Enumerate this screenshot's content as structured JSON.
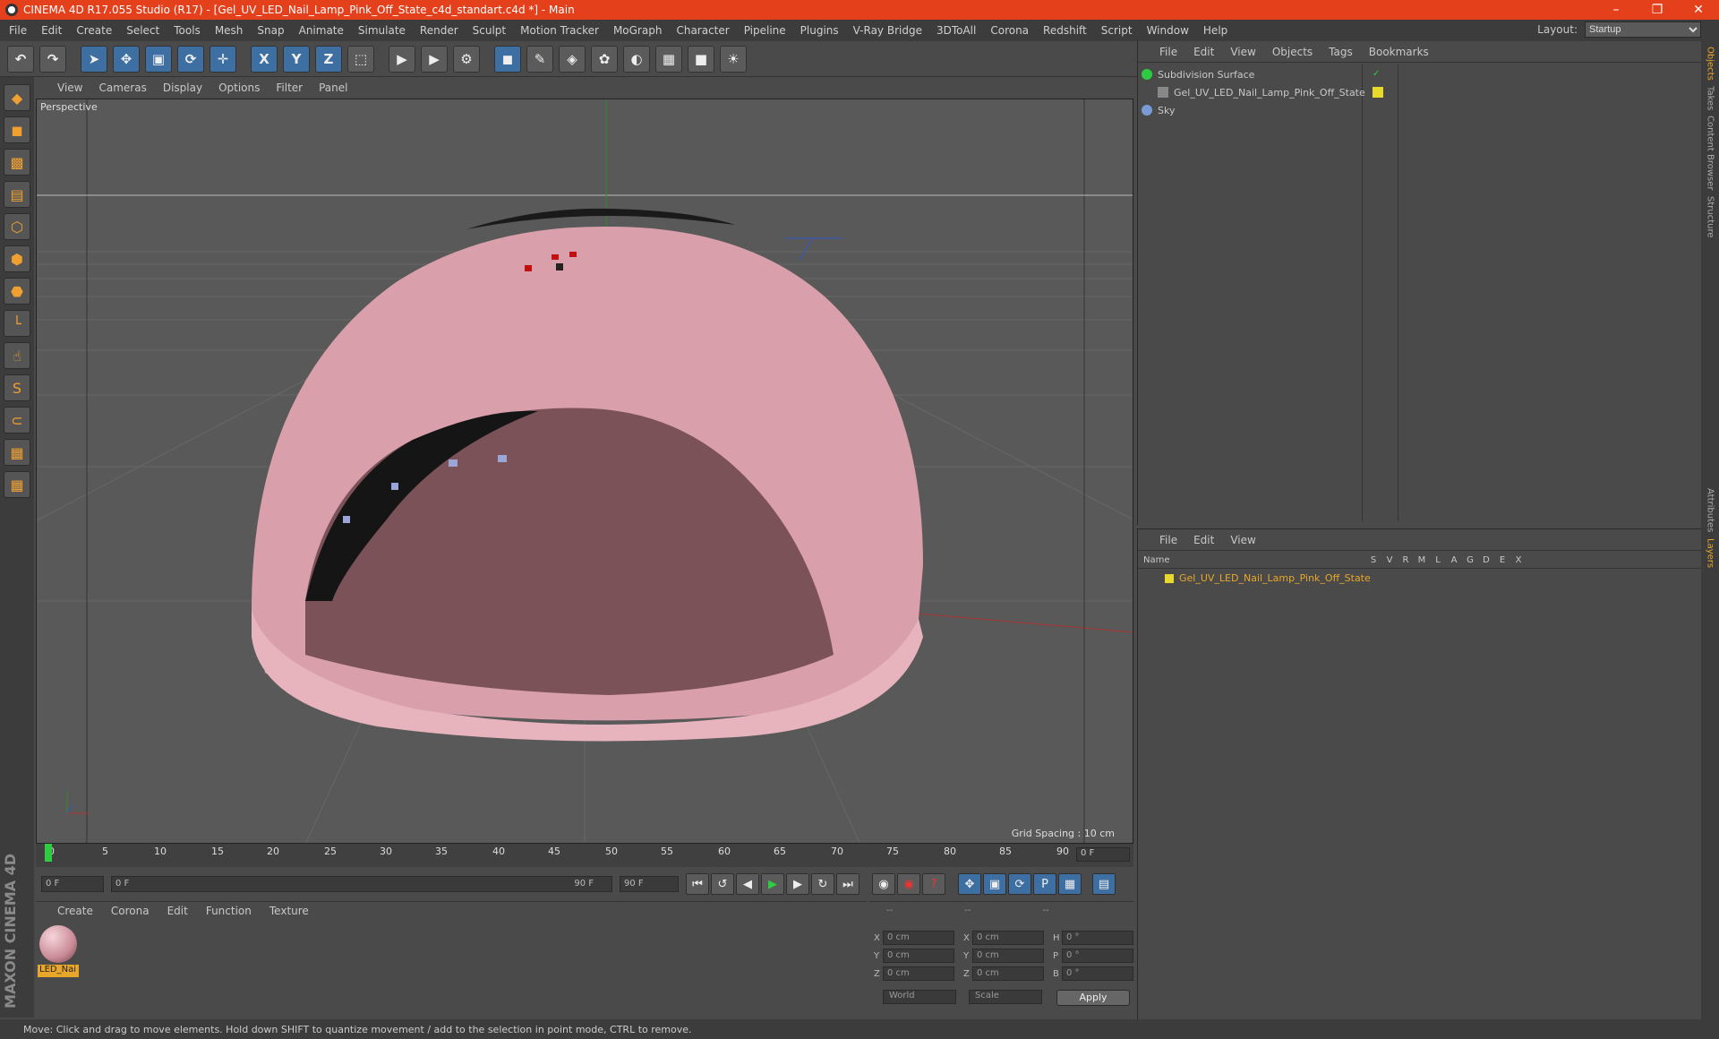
{
  "window": {
    "title": "CINEMA 4D R17.055 Studio (R17) - [Gel_UV_LED_Nail_Lamp_Pink_Off_State_c4d_standart.c4d *] - Main"
  },
  "menubar": {
    "items": [
      "File",
      "Edit",
      "Create",
      "Select",
      "Tools",
      "Mesh",
      "Snap",
      "Animate",
      "Simulate",
      "Render",
      "Sculpt",
      "Motion Tracker",
      "MoGraph",
      "Character",
      "Pipeline",
      "Plugins",
      "V-Ray Bridge",
      "3DToAll",
      "Corona",
      "Redshift",
      "Script",
      "Window",
      "Help"
    ],
    "layout_label": "Layout:",
    "layout_value": "Startup"
  },
  "viewport": {
    "menu": [
      "View",
      "Cameras",
      "Display",
      "Options",
      "Filter",
      "Panel"
    ],
    "label": "Perspective",
    "grid_spacing": "Grid Spacing : 10 cm"
  },
  "timeline": {
    "ticks": [
      "0",
      "5",
      "10",
      "15",
      "20",
      "25",
      "30",
      "35",
      "40",
      "45",
      "50",
      "55",
      "60",
      "65",
      "70",
      "75",
      "80",
      "85",
      "90"
    ],
    "current_frame": "0 F",
    "start": "0 F",
    "slider_start": "0 F",
    "slider_end": "90 F",
    "end": "90 F"
  },
  "materials": {
    "menu": [
      "Create",
      "Corona",
      "Edit",
      "Function",
      "Texture"
    ],
    "items": [
      {
        "name": "LED_Nai"
      }
    ]
  },
  "coords": {
    "headers": [
      "--",
      "--",
      "--"
    ],
    "rows": [
      {
        "a1": "X",
        "v1": "0 cm",
        "a2": "X",
        "v2": "0 cm",
        "a3": "H",
        "v3": "0 °"
      },
      {
        "a1": "Y",
        "v1": "0 cm",
        "a2": "Y",
        "v2": "0 cm",
        "a3": "P",
        "v3": "0 °"
      },
      {
        "a1": "Z",
        "v1": "0 cm",
        "a2": "Z",
        "v2": "0 cm",
        "a3": "B",
        "v3": "0 °"
      }
    ],
    "space": "World",
    "mode": "Scale",
    "apply": "Apply"
  },
  "object_manager": {
    "menu": [
      "File",
      "Edit",
      "View",
      "Objects",
      "Tags",
      "Bookmarks"
    ],
    "objects": [
      {
        "name": "Subdivision Surface"
      },
      {
        "name": "Gel_UV_LED_Nail_Lamp_Pink_Off_State"
      },
      {
        "name": "Sky"
      }
    ]
  },
  "layer_manager": {
    "menu": [
      "File",
      "Edit",
      "View"
    ],
    "name_header": "Name",
    "columns": [
      "S",
      "V",
      "R",
      "M",
      "L",
      "A",
      "G",
      "D",
      "E",
      "X"
    ],
    "layers": [
      {
        "name": "Gel_UV_LED_Nail_Lamp_Pink_Off_State"
      }
    ]
  },
  "side_tabs": [
    "Objects",
    "Takes",
    "Content Browser",
    "Structure",
    "Attributes",
    "Layers"
  ],
  "status": "Move: Click and drag to move elements. Hold down SHIFT to quantize movement / add to the selection in point mode, CTRL to remove.",
  "brand": "MAXON CINEMA 4D",
  "colors": {
    "titlebar": "#e5401c",
    "accent": "#e8a72a",
    "model": "#d9a0ab"
  }
}
